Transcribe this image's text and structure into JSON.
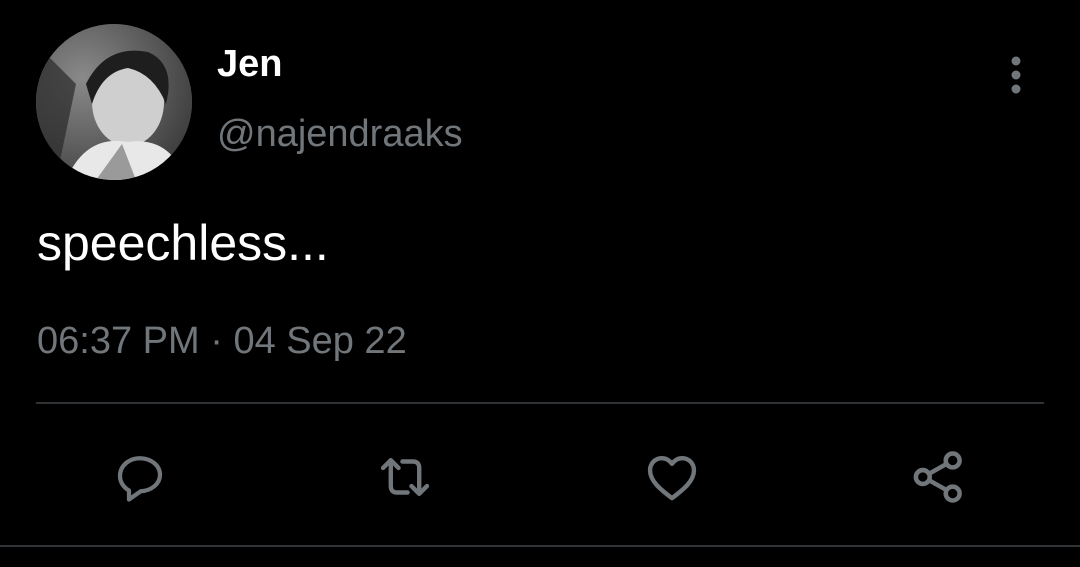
{
  "tweet": {
    "author": {
      "display_name": "Jen",
      "handle": "@najendraaks"
    },
    "text": "speechless...",
    "time": "06:37 PM",
    "separator": "·",
    "date": "04 Sep 22"
  },
  "actions": {
    "icons": [
      "reply-icon",
      "retweet-icon",
      "like-icon",
      "share-icon"
    ]
  },
  "colors": {
    "background": "#000000",
    "primary_text": "#ffffff",
    "secondary_text": "#71767b",
    "divider": "#2f3336",
    "icon": "#71767b"
  }
}
